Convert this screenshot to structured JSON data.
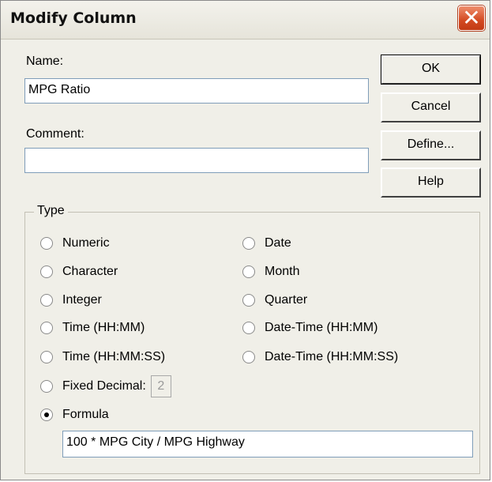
{
  "dialog": {
    "title": "Modify Column",
    "close_glyph": "✕"
  },
  "name": {
    "label": "Name:",
    "value": "MPG Ratio"
  },
  "comment": {
    "label": "Comment:",
    "value": ""
  },
  "buttons": {
    "ok": "OK",
    "cancel": "Cancel",
    "define": "Define...",
    "help": "Help"
  },
  "type": {
    "legend": "Type",
    "left": [
      "Numeric",
      "Character",
      "Integer",
      "Time (HH:MM)",
      "Time (HH:MM:SS)",
      "Fixed Decimal:",
      "Formula"
    ],
    "right": [
      "Date",
      "Month",
      "Quarter",
      "Date-Time (HH:MM)",
      "Date-Time (HH:MM:SS)"
    ],
    "selected": "Formula",
    "fixed_decimal_value": "2",
    "formula_value": "100 * MPG City / MPG Highway"
  },
  "colors": {
    "close_button": "#d34a22",
    "dialog_bg": "#f0efe8"
  }
}
